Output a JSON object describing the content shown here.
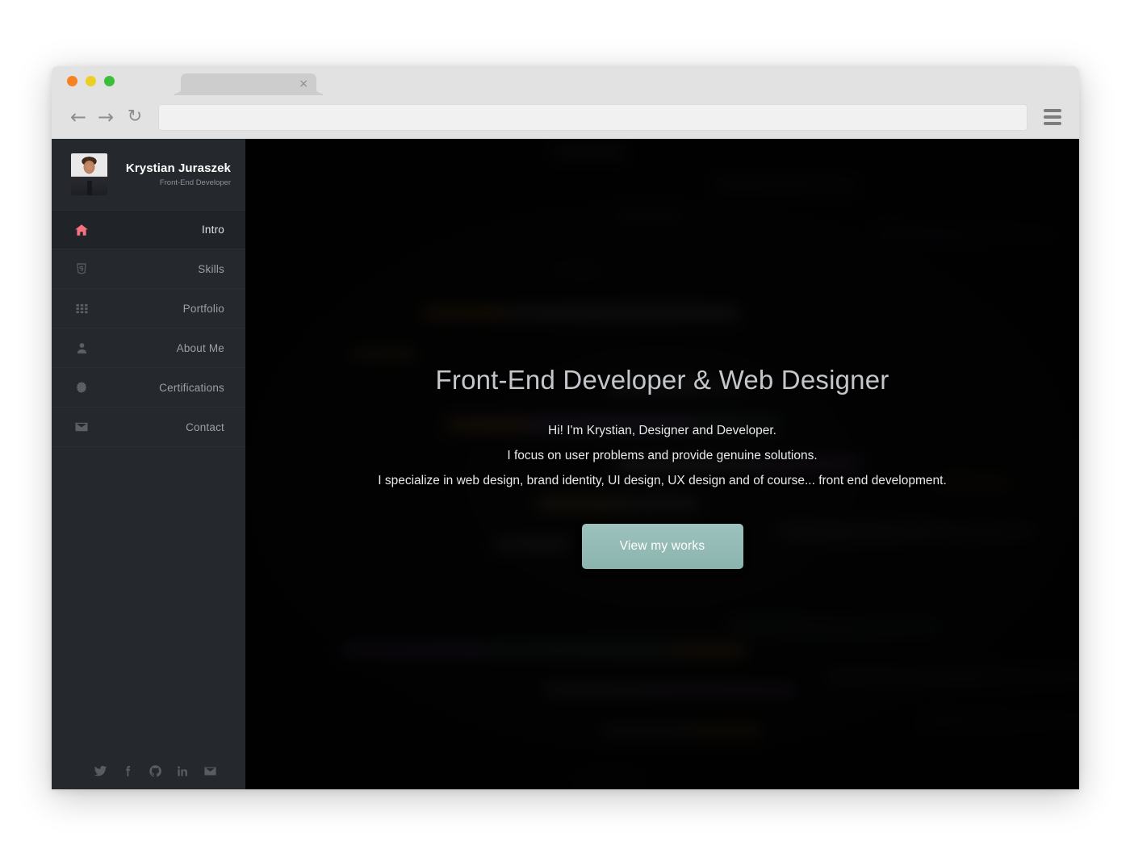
{
  "browser": {
    "traffic_lights": [
      {
        "name": "close",
        "color": "#f68220"
      },
      {
        "name": "minimize",
        "color": "#eccf24"
      },
      {
        "name": "maximize",
        "color": "#3bbf3b"
      }
    ],
    "tab": {
      "title": "",
      "close_label": "×"
    },
    "nav": {
      "back_icon": "←",
      "forward_icon": "→",
      "reload_icon": "↻"
    },
    "url": {
      "value": "",
      "placeholder": ""
    },
    "menu_icon": "hamburger-menu-icon"
  },
  "sidebar": {
    "profile": {
      "name": "Krystian Juraszek",
      "role": "Front-End Developer",
      "avatar": "portrait-photo"
    },
    "items": [
      {
        "label": "Intro",
        "icon": "home-icon",
        "active": true
      },
      {
        "label": "Skills",
        "icon": "html5-icon",
        "active": false
      },
      {
        "label": "Portfolio",
        "icon": "grid-icon",
        "active": false
      },
      {
        "label": "About Me",
        "icon": "person-icon",
        "active": false
      },
      {
        "label": "Certifications",
        "icon": "badge-icon",
        "active": false
      },
      {
        "label": "Contact",
        "icon": "envelope-icon",
        "active": false
      }
    ],
    "social": [
      {
        "name": "twitter-icon"
      },
      {
        "name": "facebook-icon"
      },
      {
        "name": "github-icon"
      },
      {
        "name": "linkedin-icon"
      },
      {
        "name": "email-icon"
      }
    ],
    "colors": {
      "background": "#25282c",
      "active_background": "#202327",
      "active_accent": "#f4717f",
      "label": "#9aa0a6"
    }
  },
  "hero": {
    "title": "Front-End Developer & Web Designer",
    "lines": [
      "Hi! I'm Krystian, Designer and Developer.",
      "I focus on user problems and provide genuine solutions.",
      "I specialize in web design, brand identity, UI design, UX design and of course... front end development."
    ],
    "cta_label": "View my works",
    "cta_color": "#8cb4ae"
  }
}
